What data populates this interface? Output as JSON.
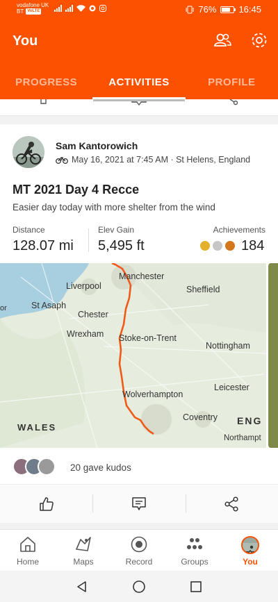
{
  "status_bar": {
    "carrier1": "vodafone UK",
    "carrier2": "BT",
    "volte_badge": "VoLTE",
    "battery": "76%",
    "time": "16:45",
    "battery_level": 0.76
  },
  "header": {
    "title": "You",
    "tabs": [
      {
        "label": "PROGRESS",
        "active": false
      },
      {
        "label": "ACTIVITIES",
        "active": true
      },
      {
        "label": "PROFILE",
        "active": false
      }
    ]
  },
  "activity": {
    "athlete_name": "Sam Kantorowich",
    "meta": "May 16, 2021 at 7:45 AM · St Helens, England",
    "title": "MT 2021 Day 4 Recce",
    "description": "Easier day today with more shelter from the wind",
    "stats": {
      "distance_label": "Distance",
      "distance_value": "128.07 mi",
      "elev_label": "Elev Gain",
      "elev_value": "5,495 ft",
      "achievements_label": "Achievements",
      "achievements_value": "184"
    },
    "map_labels": {
      "manchester": "Manchester",
      "liverpool": "Liverpool",
      "sheffield": "Sheffield",
      "st_asaph": "St Asaph",
      "chester": "Chester",
      "wrexham": "Wrexham",
      "stoke": "Stoke-on-Trent",
      "nottingham": "Nottingham",
      "leicester": "Leicester",
      "wolverhampton": "Wolverhampton",
      "coventry": "Coventry",
      "wales": "WALES",
      "england": "ENG",
      "northampton": "Northampt",
      "or": "or"
    },
    "kudos_text": "20 gave kudos"
  },
  "bottom_nav": [
    {
      "label": "Home",
      "icon": "home-icon",
      "active": false
    },
    {
      "label": "Maps",
      "icon": "map-icon",
      "active": false
    },
    {
      "label": "Record",
      "icon": "record-icon",
      "active": false
    },
    {
      "label": "Groups",
      "icon": "groups-icon",
      "active": false
    },
    {
      "label": "You",
      "icon": "profile-avatar",
      "active": true
    }
  ],
  "colors": {
    "brand": "#fc5200",
    "route": "#f05a18",
    "gold": "#e4b12d",
    "silver": "#c7c7c7",
    "bronze": "#d4781e"
  }
}
